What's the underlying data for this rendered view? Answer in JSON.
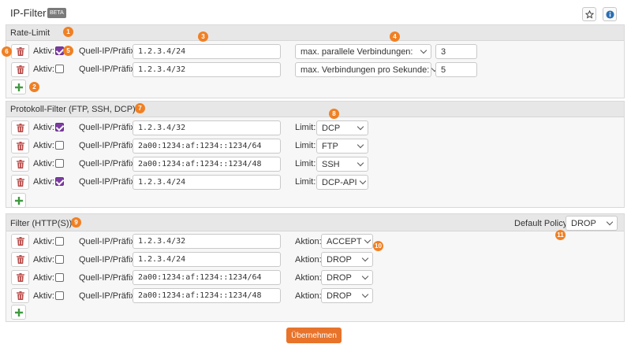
{
  "header": {
    "title": "IP-Filter",
    "beta": "BETA",
    "star_icon": "star-icon",
    "info_icon": "info-icon"
  },
  "common": {
    "active_label": "Aktiv:",
    "prefix_label": "Quell-IP/Präfix:",
    "limit_label": "Limit:",
    "action_label": "Aktion:"
  },
  "rate_limit": {
    "title": "Rate-Limit",
    "rows": [
      {
        "active": true,
        "prefix": "1.2.3.4/24",
        "limit_type": "max. parallele Verbindungen:",
        "value": "3"
      },
      {
        "active": false,
        "prefix": "1.2.3.4/32",
        "limit_type": "max. Verbindungen pro Sekunde:",
        "value": "5"
      }
    ]
  },
  "protocol_filter": {
    "title": "Protokoll-Filter (FTP, SSH, DCP)",
    "rows": [
      {
        "active": true,
        "prefix": "1.2.3.4/32",
        "limit": "DCP"
      },
      {
        "active": false,
        "prefix": "2a00:1234:af:1234::1234/64",
        "limit": "FTP"
      },
      {
        "active": false,
        "prefix": "2a00:1234:af:1234::1234/48",
        "limit": "SSH"
      },
      {
        "active": true,
        "prefix": "1.2.3.4/24",
        "limit": "DCP-API"
      }
    ]
  },
  "http_filter": {
    "title": "Filter (HTTP(S))",
    "default_policy_label": "Default Policy:",
    "default_policy": "DROP",
    "rows": [
      {
        "active": false,
        "prefix": "1.2.3.4/32",
        "action": "ACCEPT"
      },
      {
        "active": false,
        "prefix": "1.2.3.4/24",
        "action": "DROP"
      },
      {
        "active": false,
        "prefix": "2a00:1234:af:1234::1234/64",
        "action": "DROP"
      },
      {
        "active": false,
        "prefix": "2a00:1234:af:1234::1234/48",
        "action": "DROP"
      }
    ]
  },
  "annotations": [
    "1",
    "2",
    "3",
    "4",
    "5",
    "6",
    "7",
    "8",
    "9",
    "10",
    "11"
  ],
  "apply_label": "Übernehmen",
  "colors": {
    "accent": "#e8732a",
    "badge": "#f08024",
    "checkbox": "#7b3da0",
    "add": "#3f9a3f",
    "trash": "#b94a48"
  }
}
